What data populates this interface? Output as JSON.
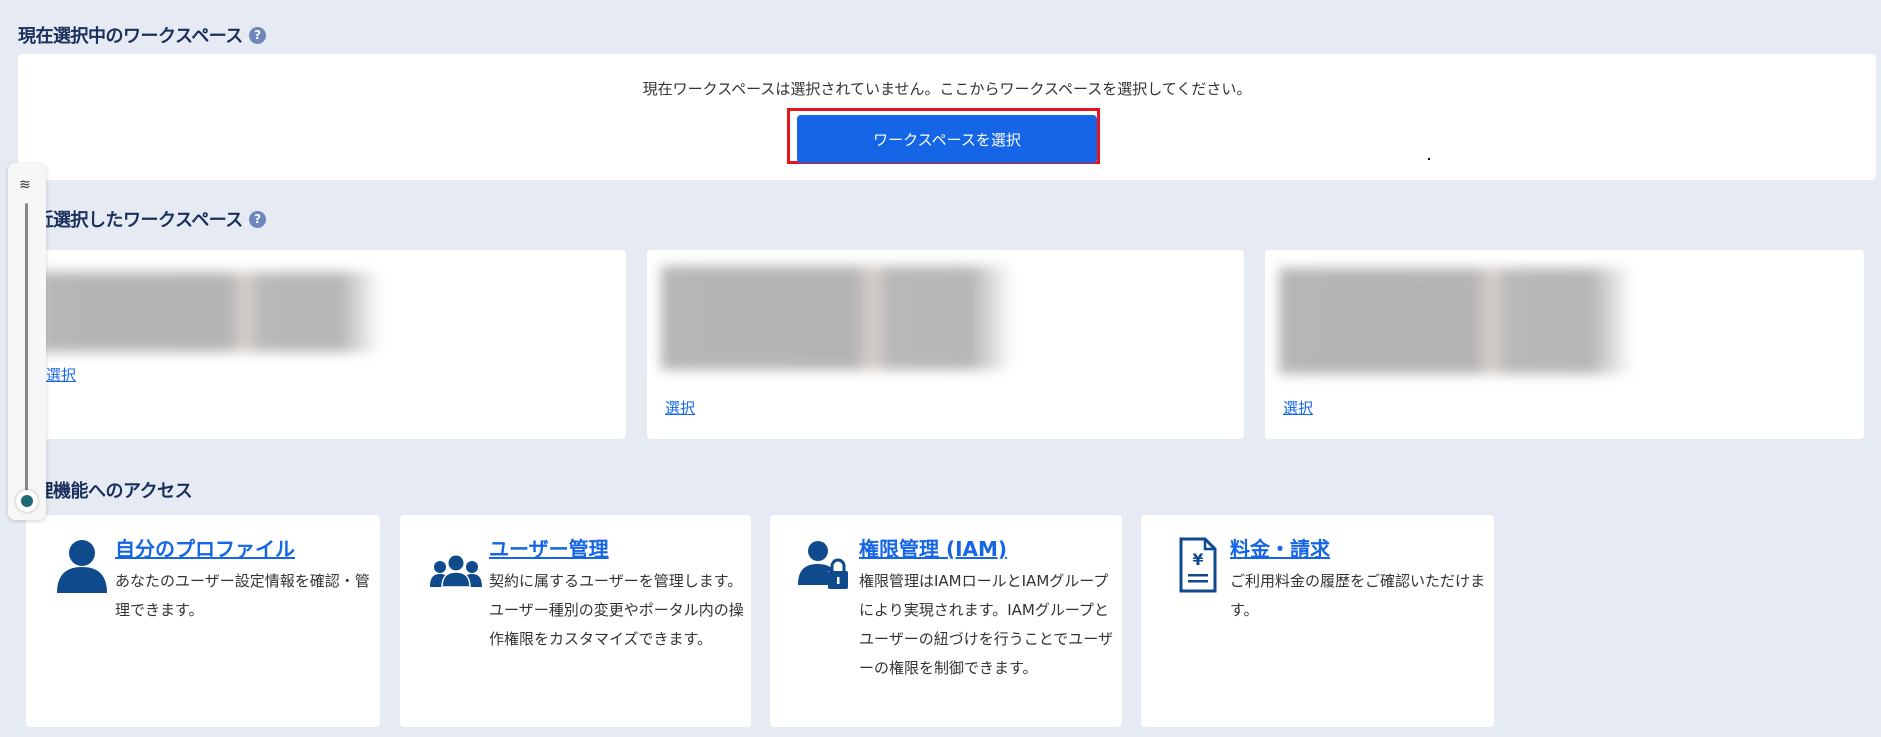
{
  "current": {
    "heading": "現在選択中のワークスペース",
    "help_icon": "question-circle-icon",
    "message": "現在ワークスペースは選択されていません。ここからワークスペースを選択してください。",
    "select_button": "ワークスペースを選択",
    "highlight_color": "#e8141c"
  },
  "recent": {
    "heading": "最近選択したワークスペース",
    "items": [
      {
        "select_label": "選択"
      },
      {
        "select_label": "選択"
      },
      {
        "select_label": "選択"
      }
    ]
  },
  "access": {
    "heading": "管理機能へのアクセス",
    "items": [
      {
        "icon": "user-icon",
        "title": "自分のプロファイル",
        "description": "あなたのユーザー設定情報を確認・管理できます。"
      },
      {
        "icon": "users-group-icon",
        "title": "ユーザー管理",
        "description": "契約に属するユーザーを管理します。ユーザー種別の変更やポータル内の操作権限をカスタマイズできます。"
      },
      {
        "icon": "user-lock-icon",
        "title": "権限管理 (IAM)",
        "description": "権限管理はIAMロールとIAMグループにより実現されます。IAMグループとユーザーの紐づけを行うことでユーザーの権限を制御できます。"
      },
      {
        "icon": "yen-invoice-icon",
        "title": "料金・請求",
        "description": "ご利用料金の履歴をご確認いただけます。"
      }
    ]
  },
  "colors": {
    "background": "#e6eaf3",
    "accent": "#1466e6",
    "heading": "#1b2f5c",
    "icon": "#0e4a8c"
  },
  "zoom_slider": {
    "icon": "waves-icon",
    "level": 0
  }
}
